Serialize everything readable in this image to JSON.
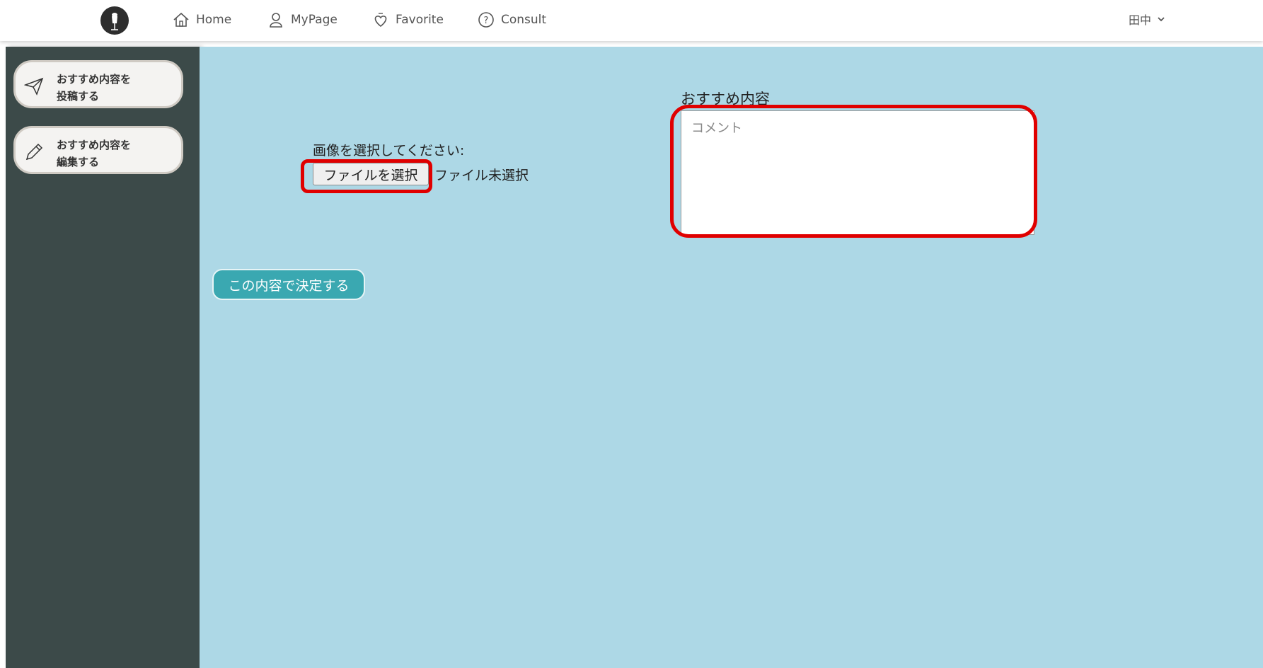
{
  "navbar": {
    "logo_icon": "dress-form-icon",
    "items": [
      {
        "label": "Home",
        "icon": "home-icon"
      },
      {
        "label": "MyPage",
        "icon": "user-icon"
      },
      {
        "label": "Favorite",
        "icon": "heart-icon"
      },
      {
        "label": "Consult",
        "icon": "question-icon"
      }
    ],
    "user": {
      "name": "田中",
      "icon": "chevron-down-icon"
    }
  },
  "sidebar": {
    "items": [
      {
        "label": "おすすめ内容を\n投稿する",
        "icon": "paper-plane-icon"
      },
      {
        "label": "おすすめ内容を\n編集する",
        "icon": "pencil-icon"
      }
    ]
  },
  "form": {
    "image_label": "画像を選択してください:",
    "file_button": "ファイルを選択",
    "file_status": "ファイル未選択",
    "recommend_title": "おすすめ内容",
    "comment_placeholder": "コメント",
    "comment_value": "",
    "submit_button": "この内容で決定する"
  },
  "colors": {
    "main_bg": "#add8e6",
    "sidebar_bg": "#3c4a49",
    "submit_bg": "#3aa8b1",
    "highlight": "#e00000"
  }
}
